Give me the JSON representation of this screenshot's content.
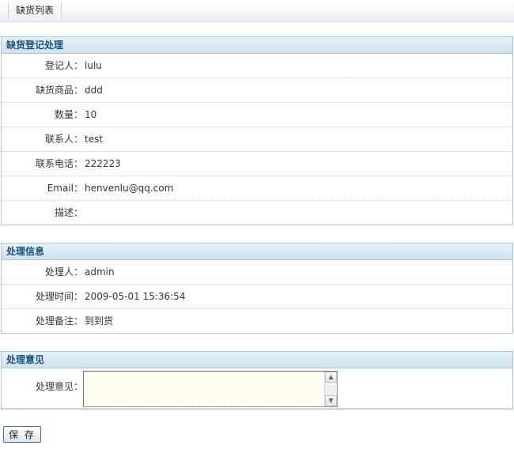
{
  "topbar": {
    "tab_label": "缺货列表"
  },
  "registration": {
    "title": "缺货登记处理",
    "rows": [
      {
        "label": "登记人：",
        "value": "lulu"
      },
      {
        "label": "缺货商品：",
        "value": "ddd"
      },
      {
        "label": "数量：",
        "value": "10"
      },
      {
        "label": "联系人：",
        "value": "test"
      },
      {
        "label": "联系电话：",
        "value": "222223"
      },
      {
        "label": "Email：",
        "value": "henvenlu@qq.com"
      },
      {
        "label": "描述：",
        "value": ""
      }
    ]
  },
  "processing": {
    "title": "处理信息",
    "rows": [
      {
        "label": "处理人：",
        "value": "admin"
      },
      {
        "label": "处理时间：",
        "value": "2009-05-01 15:36:54"
      },
      {
        "label": "处理备注：",
        "value": "到到货"
      }
    ]
  },
  "opinion": {
    "title": "处理意见",
    "label": "处理意见：",
    "value": ""
  },
  "actions": {
    "save_label": "保 存"
  }
}
